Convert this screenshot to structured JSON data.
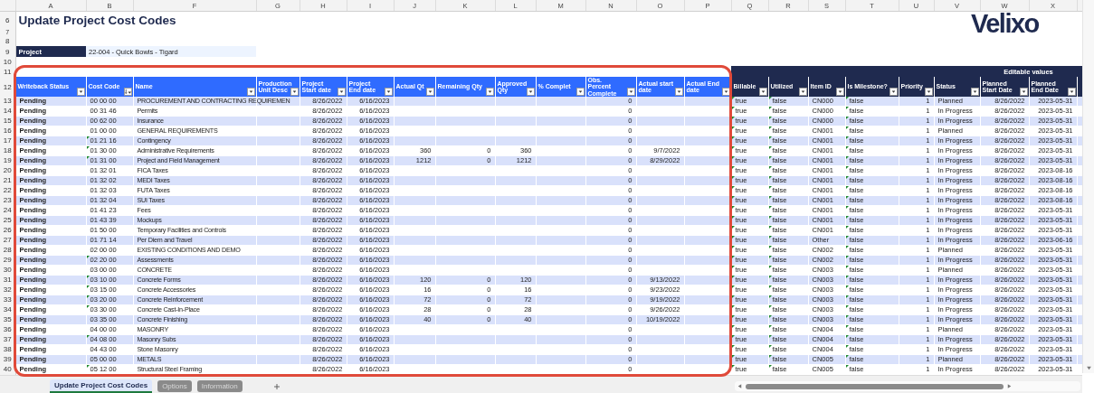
{
  "sheet": {
    "title": "Update Project Cost Codes",
    "logo": "Velixo",
    "project_label": "Project",
    "project_value": "22-004 - Quick Bowls - Tigard",
    "editable_label": "Editable values",
    "column_letters": [
      "A",
      "B",
      "F",
      "G",
      "H",
      "I",
      "J",
      "K",
      "L",
      "M",
      "N",
      "O",
      "P",
      "Q",
      "R",
      "S",
      "T",
      "U",
      "V",
      "W",
      "X"
    ],
    "top_row_numbers": [
      "6",
      "7",
      "8",
      "9",
      "10",
      "11",
      "12"
    ],
    "columns": [
      {
        "label": "Writeback Status",
        "sorted": false,
        "flagged": false
      },
      {
        "label": "Cost Code",
        "sorted": true,
        "flagged": false
      },
      {
        "label": "Name",
        "sorted": false,
        "flagged": false
      },
      {
        "label": "Production Unit Desc",
        "sorted": false,
        "flagged": false
      },
      {
        "label": "Project Start date",
        "sorted": false,
        "flagged": false
      },
      {
        "label": "Project End date",
        "sorted": false,
        "flagged": false
      },
      {
        "label": "Actual Qt",
        "sorted": false,
        "flagged": false
      },
      {
        "label": "Remaining Qty",
        "sorted": false,
        "flagged": false
      },
      {
        "label": "Approved Qty",
        "sorted": false,
        "flagged": false
      },
      {
        "label": "% Complet",
        "sorted": false,
        "flagged": false
      },
      {
        "label": "Obs. Percent Complete",
        "sorted": false,
        "flagged": false
      },
      {
        "label": "Actual start date",
        "sorted": false,
        "flagged": false
      },
      {
        "label": "Actual End date",
        "sorted": false,
        "flagged": false
      },
      {
        "label": "Billable",
        "sorted": false,
        "flagged": true
      },
      {
        "label": "Utilized",
        "sorted": false,
        "flagged": true
      },
      {
        "label": "Item ID",
        "sorted": false,
        "flagged": false
      },
      {
        "label": "Is Milestone?",
        "sorted": false,
        "flagged": true
      },
      {
        "label": "Priority",
        "sorted": false,
        "flagged": false
      },
      {
        "label": "Status",
        "sorted": false,
        "flagged": false
      },
      {
        "label": "Planned Start Date",
        "sorted": false,
        "flagged": false
      },
      {
        "label": "Planned End Date",
        "sorted": false,
        "flagged": false
      }
    ],
    "rows": [
      {
        "n": "13",
        "status": "Pending",
        "code": "00 00 00",
        "code_flag": false,
        "name": "PROCUREMENT AND CONTRACTING REQUIREMEN",
        "start": "8/26/2022",
        "end": "6/16/2023",
        "obs": "0",
        "billable": "true",
        "utilized": "false",
        "item_id": "CN000",
        "milestone": "false",
        "priority": "1",
        "state": "Planned",
        "planned_start": "8/26/2022",
        "planned_end": "2023-05-31"
      },
      {
        "n": "14",
        "status": "Pending",
        "code": "00 31 46",
        "code_flag": false,
        "name": "Permits",
        "start": "8/26/2022",
        "end": "6/16/2023",
        "obs": "0",
        "billable": "true",
        "utilized": "false",
        "item_id": "CN000",
        "milestone": "false",
        "priority": "1",
        "state": "In Progress",
        "planned_start": "8/26/2022",
        "planned_end": "2023-05-31"
      },
      {
        "n": "15",
        "status": "Pending",
        "code": "00 62 00",
        "code_flag": false,
        "name": "Insurance",
        "start": "8/26/2022",
        "end": "6/16/2023",
        "obs": "0",
        "billable": "true",
        "utilized": "false",
        "item_id": "CN000",
        "milestone": "false",
        "priority": "1",
        "state": "In Progress",
        "planned_start": "8/26/2022",
        "planned_end": "2023-05-31"
      },
      {
        "n": "16",
        "status": "Pending",
        "code": "01 00 00",
        "code_flag": false,
        "name": "GENERAL REQUIREMENTS",
        "start": "8/26/2022",
        "end": "6/16/2023",
        "obs": "0",
        "billable": "true",
        "utilized": "false",
        "item_id": "CN001",
        "milestone": "false",
        "priority": "1",
        "state": "Planned",
        "planned_start": "8/26/2022",
        "planned_end": "2023-05-31"
      },
      {
        "n": "17",
        "status": "Pending",
        "code": "01 21 16",
        "code_flag": true,
        "name": "Contingency",
        "start": "8/26/2022",
        "end": "6/16/2023",
        "obs": "0",
        "billable": "true",
        "utilized": "false",
        "item_id": "CN001",
        "milestone": "false",
        "priority": "1",
        "state": "In Progress",
        "planned_start": "8/26/2022",
        "planned_end": "2023-05-31"
      },
      {
        "n": "18",
        "status": "Pending",
        "code": "01 30 00",
        "code_flag": true,
        "name": "Administrative Requirements",
        "start": "8/26/2022",
        "end": "6/16/2023",
        "actual_qty": "360",
        "remaining_qty": "0",
        "approved_qty": "360",
        "obs": "0",
        "actual_start": "9/7/2022",
        "billable": "true",
        "utilized": "false",
        "item_id": "CN001",
        "milestone": "false",
        "priority": "1",
        "state": "In Progress",
        "planned_start": "8/26/2022",
        "planned_end": "2023-05-31"
      },
      {
        "n": "19",
        "status": "Pending",
        "code": "01 31 00",
        "code_flag": true,
        "name": "Project and Field Management",
        "start": "8/26/2022",
        "end": "6/16/2023",
        "actual_qty": "1212",
        "remaining_qty": "0",
        "approved_qty": "1212",
        "obs": "0",
        "actual_start": "8/29/2022",
        "billable": "true",
        "utilized": "false",
        "item_id": "CN001",
        "milestone": "false",
        "priority": "1",
        "state": "In Progress",
        "planned_start": "8/26/2022",
        "planned_end": "2023-05-31"
      },
      {
        "n": "20",
        "status": "Pending",
        "code": "01 32 01",
        "code_flag": false,
        "name": "FICA Taxes",
        "start": "8/26/2022",
        "end": "6/16/2023",
        "obs": "0",
        "billable": "true",
        "utilized": "false",
        "item_id": "CN001",
        "milestone": "false",
        "priority": "1",
        "state": "In Progress",
        "planned_start": "8/26/2022",
        "planned_end": "2023-08-16"
      },
      {
        "n": "21",
        "status": "Pending",
        "code": "01 32 02",
        "code_flag": false,
        "name": "MEDI Taxes",
        "start": "8/26/2022",
        "end": "6/16/2023",
        "obs": "0",
        "billable": "true",
        "utilized": "false",
        "item_id": "CN001",
        "milestone": "false",
        "priority": "1",
        "state": "In Progress",
        "planned_start": "8/26/2022",
        "planned_end": "2023-08-16"
      },
      {
        "n": "22",
        "status": "Pending",
        "code": "01 32 03",
        "code_flag": false,
        "name": "FUTA Taxes",
        "start": "8/26/2022",
        "end": "6/16/2023",
        "obs": "0",
        "billable": "true",
        "utilized": "false",
        "item_id": "CN001",
        "milestone": "false",
        "priority": "1",
        "state": "In Progress",
        "planned_start": "8/26/2022",
        "planned_end": "2023-08-16"
      },
      {
        "n": "23",
        "status": "Pending",
        "code": "01 32 04",
        "code_flag": false,
        "name": "SUI Taxes",
        "start": "8/26/2022",
        "end": "6/16/2023",
        "obs": "0",
        "billable": "true",
        "utilized": "false",
        "item_id": "CN001",
        "milestone": "false",
        "priority": "1",
        "state": "In Progress",
        "planned_start": "8/26/2022",
        "planned_end": "2023-08-16"
      },
      {
        "n": "24",
        "status": "Pending",
        "code": "01 41 23",
        "code_flag": false,
        "name": "Fees",
        "start": "8/26/2022",
        "end": "6/16/2023",
        "obs": "0",
        "billable": "true",
        "utilized": "false",
        "item_id": "CN001",
        "milestone": "false",
        "priority": "1",
        "state": "In Progress",
        "planned_start": "8/26/2022",
        "planned_end": "2023-05-31"
      },
      {
        "n": "25",
        "status": "Pending",
        "code": "01 43 39",
        "code_flag": false,
        "name": "Mockups",
        "start": "8/26/2022",
        "end": "6/16/2023",
        "obs": "0",
        "billable": "true",
        "utilized": "false",
        "item_id": "CN001",
        "milestone": "false",
        "priority": "1",
        "state": "In Progress",
        "planned_start": "8/26/2022",
        "planned_end": "2023-05-31"
      },
      {
        "n": "26",
        "status": "Pending",
        "code": "01 50 00",
        "code_flag": false,
        "name": "Temporary Facilities and Controls",
        "start": "8/26/2022",
        "end": "6/16/2023",
        "obs": "0",
        "billable": "true",
        "utilized": "false",
        "item_id": "CN001",
        "milestone": "false",
        "priority": "1",
        "state": "In Progress",
        "planned_start": "8/26/2022",
        "planned_end": "2023-05-31"
      },
      {
        "n": "27",
        "status": "Pending",
        "code": "01 71 14",
        "code_flag": false,
        "name": "Per Diem and Travel",
        "start": "8/26/2022",
        "end": "6/16/2023",
        "obs": "0",
        "billable": "true",
        "utilized": "false",
        "item_id": "Other",
        "milestone": "false",
        "priority": "1",
        "state": "In Progress",
        "planned_start": "8/26/2022",
        "planned_end": "2023-06-16"
      },
      {
        "n": "28",
        "status": "Pending",
        "code": "02 00 00",
        "code_flag": false,
        "name": "EXISTING CONDITIONS AND DEMO",
        "start": "8/26/2022",
        "end": "6/16/2023",
        "obs": "0",
        "billable": "true",
        "utilized": "false",
        "item_id": "CN002",
        "milestone": "false",
        "priority": "1",
        "state": "Planned",
        "planned_start": "8/26/2022",
        "planned_end": "2023-05-31"
      },
      {
        "n": "29",
        "status": "Pending",
        "code": "02 20 00",
        "code_flag": true,
        "name": "Assessments",
        "start": "8/26/2022",
        "end": "6/16/2023",
        "obs": "0",
        "billable": "true",
        "utilized": "false",
        "item_id": "CN002",
        "milestone": "false",
        "priority": "1",
        "state": "In Progress",
        "planned_start": "8/26/2022",
        "planned_end": "2023-05-31"
      },
      {
        "n": "30",
        "status": "Pending",
        "code": "03 00 00",
        "code_flag": false,
        "name": "CONCRETE",
        "start": "8/26/2022",
        "end": "6/16/2023",
        "obs": "0",
        "billable": "true",
        "utilized": "false",
        "item_id": "CN003",
        "milestone": "false",
        "priority": "1",
        "state": "Planned",
        "planned_start": "8/26/2022",
        "planned_end": "2023-05-31"
      },
      {
        "n": "31",
        "status": "Pending",
        "code": "03 10 00",
        "code_flag": true,
        "name": "Concrete Forms",
        "start": "8/26/2022",
        "end": "6/16/2023",
        "actual_qty": "120",
        "remaining_qty": "0",
        "approved_qty": "120",
        "obs": "0",
        "actual_start": "9/13/2022",
        "billable": "true",
        "utilized": "false",
        "item_id": "CN003",
        "milestone": "false",
        "priority": "1",
        "state": "In Progress",
        "planned_start": "8/26/2022",
        "planned_end": "2023-05-31"
      },
      {
        "n": "32",
        "status": "Pending",
        "code": "03 15 00",
        "code_flag": true,
        "name": "Concrete Accessories",
        "start": "8/26/2022",
        "end": "6/16/2023",
        "actual_qty": "16",
        "remaining_qty": "0",
        "approved_qty": "16",
        "obs": "0",
        "actual_start": "9/23/2022",
        "billable": "true",
        "utilized": "false",
        "item_id": "CN003",
        "milestone": "false",
        "priority": "1",
        "state": "In Progress",
        "planned_start": "8/26/2022",
        "planned_end": "2023-05-31"
      },
      {
        "n": "33",
        "status": "Pending",
        "code": "03 20 00",
        "code_flag": true,
        "name": "Concrete Reinforcement",
        "start": "8/26/2022",
        "end": "6/16/2023",
        "actual_qty": "72",
        "remaining_qty": "0",
        "approved_qty": "72",
        "obs": "0",
        "actual_start": "9/19/2022",
        "billable": "true",
        "utilized": "false",
        "item_id": "CN003",
        "milestone": "false",
        "priority": "1",
        "state": "In Progress",
        "planned_start": "8/26/2022",
        "planned_end": "2023-05-31"
      },
      {
        "n": "34",
        "status": "Pending",
        "code": "03 30 00",
        "code_flag": true,
        "name": "Concrete Cast-In-Place",
        "start": "8/26/2022",
        "end": "6/16/2023",
        "actual_qty": "28",
        "remaining_qty": "0",
        "approved_qty": "28",
        "obs": "0",
        "actual_start": "9/26/2022",
        "billable": "true",
        "utilized": "false",
        "item_id": "CN003",
        "milestone": "false",
        "priority": "1",
        "state": "In Progress",
        "planned_start": "8/26/2022",
        "planned_end": "2023-05-31"
      },
      {
        "n": "35",
        "status": "Pending",
        "code": "03 35 00",
        "code_flag": false,
        "name": "Concrete Finishing",
        "start": "8/26/2022",
        "end": "6/16/2023",
        "actual_qty": "40",
        "remaining_qty": "0",
        "approved_qty": "40",
        "obs": "0",
        "actual_start": "10/19/2022",
        "billable": "true",
        "utilized": "false",
        "item_id": "CN003",
        "milestone": "false",
        "priority": "1",
        "state": "In Progress",
        "planned_start": "8/26/2022",
        "planned_end": "2023-05-31"
      },
      {
        "n": "36",
        "status": "Pending",
        "code": "04 00 00",
        "code_flag": false,
        "name": "MASONRY",
        "start": "8/26/2022",
        "end": "6/16/2023",
        "obs": "0",
        "billable": "true",
        "utilized": "false",
        "item_id": "CN004",
        "milestone": "false",
        "priority": "1",
        "state": "Planned",
        "planned_start": "8/26/2022",
        "planned_end": "2023-05-31"
      },
      {
        "n": "37",
        "status": "Pending",
        "code": "04 08 00",
        "code_flag": true,
        "name": "Masonry Subs",
        "start": "8/26/2022",
        "end": "6/16/2023",
        "obs": "0",
        "billable": "true",
        "utilized": "false",
        "item_id": "CN004",
        "milestone": "false",
        "priority": "1",
        "state": "In Progress",
        "planned_start": "8/26/2022",
        "planned_end": "2023-05-31"
      },
      {
        "n": "38",
        "status": "Pending",
        "code": "04 43 00",
        "code_flag": false,
        "name": "Stone Masonry",
        "start": "8/26/2022",
        "end": "6/16/2023",
        "obs": "0",
        "billable": "true",
        "utilized": "false",
        "item_id": "CN004",
        "milestone": "false",
        "priority": "1",
        "state": "In Progress",
        "planned_start": "8/26/2022",
        "planned_end": "2023-05-31"
      },
      {
        "n": "39",
        "status": "Pending",
        "code": "05 00 00",
        "code_flag": false,
        "name": "METALS",
        "start": "8/26/2022",
        "end": "6/16/2023",
        "obs": "0",
        "billable": "true",
        "utilized": "false",
        "item_id": "CN005",
        "milestone": "false",
        "priority": "1",
        "state": "Planned",
        "planned_start": "8/26/2022",
        "planned_end": "2023-05-31"
      },
      {
        "n": "40",
        "status": "Pending",
        "code": "05 12 00",
        "code_flag": true,
        "name": "Structural Steel Framing",
        "start": "8/26/2022",
        "end": "6/16/2023",
        "obs": "0",
        "billable": "true",
        "utilized": "false",
        "item_id": "CN005",
        "milestone": "false",
        "priority": "1",
        "state": "In Progress",
        "planned_start": "8/26/2022",
        "planned_end": "2023-05-31"
      }
    ]
  },
  "sheet_tabs": [
    {
      "label": "Update Project Cost Codes",
      "selected": true
    },
    {
      "label": "Options",
      "selected": false
    },
    {
      "label": "Information",
      "selected": false
    }
  ]
}
